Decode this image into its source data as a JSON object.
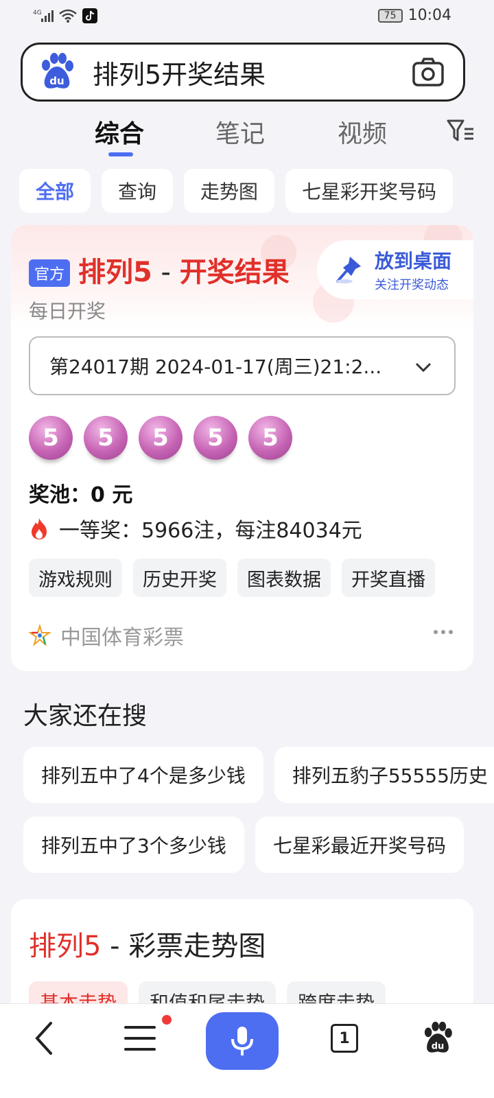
{
  "status_bar": {
    "network": "4G",
    "battery": "75",
    "time": "10:04"
  },
  "search": {
    "query": "排列5开奖结果",
    "logo_icon": "baidu-paw-icon",
    "camera_icon": "camera-icon"
  },
  "tabs": [
    {
      "label": "综合",
      "active": true
    },
    {
      "label": "笔记",
      "active": false
    },
    {
      "label": "视频",
      "active": false
    }
  ],
  "chips": [
    {
      "label": "全部",
      "active": true
    },
    {
      "label": "查询",
      "active": false
    },
    {
      "label": "走势图",
      "active": false
    },
    {
      "label": "七星彩开奖号码",
      "active": false
    }
  ],
  "result_card": {
    "official_badge": "官方",
    "title_game": "排列5",
    "title_sep": " - ",
    "title_rest": "开奖结果",
    "subtitle": "每日开奖",
    "desk_button": {
      "title": "放到桌面",
      "subtitle": "关注开奖动态"
    },
    "period_select": "第24017期 2024-01-17(周三)21:2...",
    "balls": [
      "5",
      "5",
      "5",
      "5",
      "5"
    ],
    "pool": "奖池：0 元",
    "first_prize": "一等奖：5966注，每注84034元",
    "actions": [
      "游戏规则",
      "历史开奖",
      "图表数据",
      "开奖直播"
    ],
    "source": "中国体育彩票"
  },
  "also_search": {
    "title": "大家还在搜",
    "row1": [
      "排列五中了4个是多少钱",
      "排列五豹子55555历史"
    ],
    "row2": [
      "排列五中了3个多少钱",
      "七星彩最近开奖号码"
    ]
  },
  "trend_card": {
    "title_game": "排列5",
    "title_sep": " - ",
    "title_rest": "彩票走势图",
    "tabs": [
      "基本走势",
      "和值和尾走势",
      "跨度走势"
    ]
  },
  "bottom_nav": {
    "tab_count": "1",
    "accent": "#4e6ef2"
  }
}
